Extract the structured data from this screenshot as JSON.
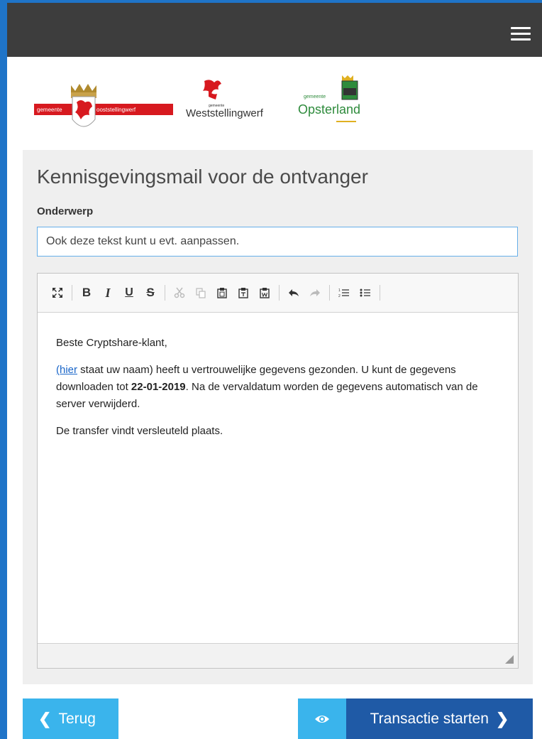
{
  "header": {
    "menu_icon": "hamburger-menu-icon"
  },
  "logos": {
    "oost": {
      "left_word": "gemeente",
      "right_word": "ooststellingwerf",
      "red": "#d7191f"
    },
    "west": {
      "small_word": "gemeente",
      "name": "Weststellingwerf",
      "red": "#d7191f"
    },
    "opster": {
      "small_word": "gemeente",
      "name": "Opsterland",
      "green": "#2e8b3c"
    }
  },
  "panel": {
    "title": "Kennisgevingsmail voor de ontvanger",
    "subject_label": "Onderwerp",
    "subject_value": "Ook deze tekst kunt u evt. aanpassen."
  },
  "editor": {
    "toolbar": [
      {
        "name": "maximize-icon",
        "glyph": "⛶"
      },
      {
        "name": "bold-button",
        "glyph": "B"
      },
      {
        "name": "italic-button",
        "glyph": "I"
      },
      {
        "name": "underline-button",
        "glyph": "U"
      },
      {
        "name": "strikethrough-button",
        "glyph": "S"
      },
      {
        "name": "cut-icon",
        "glyph": "✂"
      },
      {
        "name": "copy-icon",
        "glyph": "⎘"
      },
      {
        "name": "paste-icon",
        "glyph": "📋"
      },
      {
        "name": "paste-text-icon",
        "glyph": "📋"
      },
      {
        "name": "paste-word-icon",
        "glyph": "📋"
      },
      {
        "name": "undo-icon",
        "glyph": "↩"
      },
      {
        "name": "redo-icon",
        "glyph": "↪"
      },
      {
        "name": "numbered-list-icon",
        "glyph": "☰"
      },
      {
        "name": "bulleted-list-icon",
        "glyph": "☰"
      }
    ],
    "greeting": "Beste Cryptshare-klant,",
    "link_text": "(hier",
    "para1_a": " staat uw naam) heeft u vertrouwelijke gegevens gezonden. U kunt de gegevens downloaden tot ",
    "date": "22-01-2019",
    "para1_b": ". Na de vervaldatum worden de gegevens  automatisch van de server verwijderd.",
    "para2": "De transfer vindt versleuteld plaats."
  },
  "buttons": {
    "back": "Terug",
    "preview_icon": "eye-icon",
    "start": "Transactie starten"
  },
  "colors": {
    "accent": "#1f74c8",
    "light_blue": "#3ab4ec",
    "dark_blue": "#1f5aa6",
    "header": "#3d3d3d"
  }
}
